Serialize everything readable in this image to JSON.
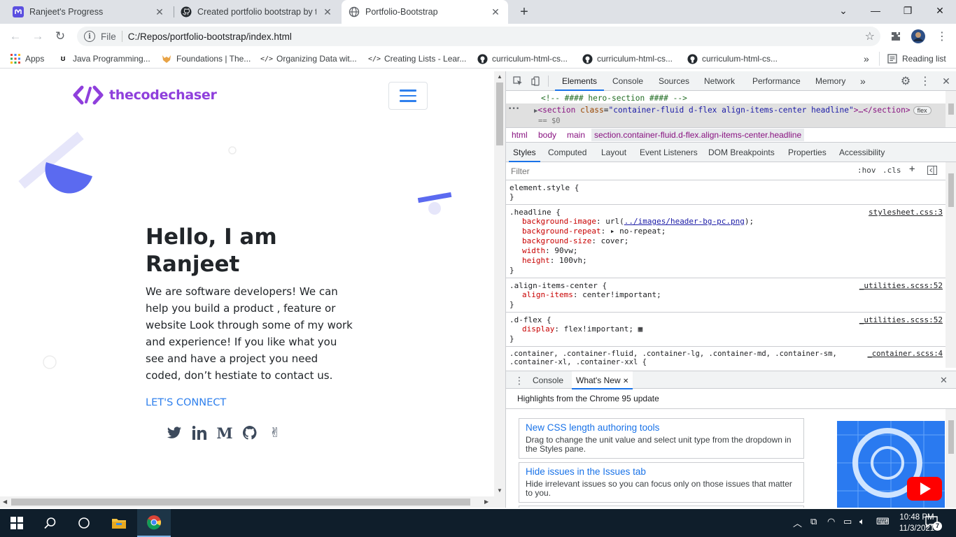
{
  "browser": {
    "tabs": [
      {
        "title": "Ranjeet's Progress",
        "favicon": "mastodon-icon",
        "active": false
      },
      {
        "title": "Created portfolio bootstrap by th",
        "favicon": "github-icon",
        "active": false
      },
      {
        "title": "Portfolio-Bootstrap",
        "favicon": "globe-icon",
        "active": true
      }
    ],
    "new_tab_label": "+",
    "address": {
      "scheme": "File",
      "url": "C:/Repos/portfolio-bootstrap/index.html"
    },
    "bookmarks": [
      {
        "label": "Apps",
        "icon": "apps-grid-icon"
      },
      {
        "label": "Java Programming...",
        "icon": "u-logo-icon"
      },
      {
        "label": "Foundations | The...",
        "icon": "fox-icon"
      },
      {
        "label": "Organizing Data wit...",
        "icon": "code-brackets-icon"
      },
      {
        "label": "Creating Lists - Lear...",
        "icon": "code-brackets-icon"
      },
      {
        "label": "curriculum-html-cs...",
        "icon": "github-icon"
      },
      {
        "label": "curriculum-html-cs...",
        "icon": "github-icon"
      },
      {
        "label": "curriculum-html-cs...",
        "icon": "github-icon"
      }
    ],
    "bookmarks_overflow": "»",
    "reading_list": "Reading list"
  },
  "page": {
    "logo_text": "thecodechaser",
    "hero_title": "Hello, I am Ranjeet",
    "hero_text": "We are software developers! We can help you build a product , feature or website Look through some of my work and experience! If you like what you see and have a project you need coded, don’t hestiate to contact us.",
    "connect": "LET'S CONNECT",
    "socials": [
      "twitter-icon",
      "linkedin-icon",
      "medium-icon",
      "github-icon",
      "angellist-icon"
    ]
  },
  "devtools": {
    "tabs": [
      "Elements",
      "Console",
      "Sources",
      "Network",
      "Performance",
      "Memory"
    ],
    "active_tab": "Elements",
    "more_tabs": "»",
    "dom": {
      "comment": "<!-- #### hero-section #### -->",
      "ellipsis": "•••",
      "tag_open": "<section",
      "attr_name": "class",
      "attr_value": "\"container-fluid d-flex align-items-center headline\"",
      "tag_rest": ">…</section>",
      "badge": "flex",
      "eq": "== $0"
    },
    "breadcrumbs": [
      "html",
      "body",
      "main",
      "section.container-fluid.d-flex.align-items-center.headline"
    ],
    "subtabs": [
      "Styles",
      "Computed",
      "Layout",
      "Event Listeners",
      "DOM Breakpoints",
      "Properties",
      "Accessibility"
    ],
    "filter_placeholder": "Filter",
    "filter_hov": ":hov",
    "filter_cls": ".cls",
    "filter_plus": "+",
    "rules": [
      {
        "selector": "element.style {",
        "source": "",
        "decls": []
      },
      {
        "selector": ".headline {",
        "source": "stylesheet.css:3",
        "decls": [
          {
            "name": "background-image",
            "value": "url(",
            "link": "../images/header-bg-pc.png",
            "after": ");"
          },
          {
            "name": "background-repeat",
            "value": "▸ no-repeat;"
          },
          {
            "name": "background-size",
            "value": "cover;"
          },
          {
            "name": "width",
            "value": "90vw;"
          },
          {
            "name": "height",
            "value": "100vh;"
          }
        ]
      },
      {
        "selector": ".align-items-center {",
        "source": "_utilities.scss:52",
        "decls": [
          {
            "name": "align-items",
            "value": "center!important;"
          }
        ]
      },
      {
        "selector": ".d-flex {",
        "source": "_utilities.scss:52",
        "decls": [
          {
            "name": "display",
            "value": "flex!important; ▦"
          }
        ]
      },
      {
        "selector": ".container, .container-fluid, .container-lg, .container-md, .container-sm,",
        "source": "_container.scss:4",
        "decls": [
          {
            "name": "",
            "value": ".container-xl, .container-xxl {"
          }
        ]
      }
    ],
    "close_brace": "}",
    "drawer_tabs": [
      "Console",
      "What's New"
    ],
    "drawer_active": "What's New",
    "highlights": "Highlights from the Chrome 95 update",
    "cards": [
      {
        "title": "New CSS length authoring tools",
        "desc": "Drag to change the unit value and select unit type from the dropdown in the Styles pane."
      },
      {
        "title": "Hide issues in the Issues tab",
        "desc": "Hide irrelevant issues so you can focus only on those issues that matter to you."
      }
    ]
  },
  "taskbar": {
    "time": "10:48 PM",
    "date": "11/3/2021",
    "notifications": "7"
  }
}
